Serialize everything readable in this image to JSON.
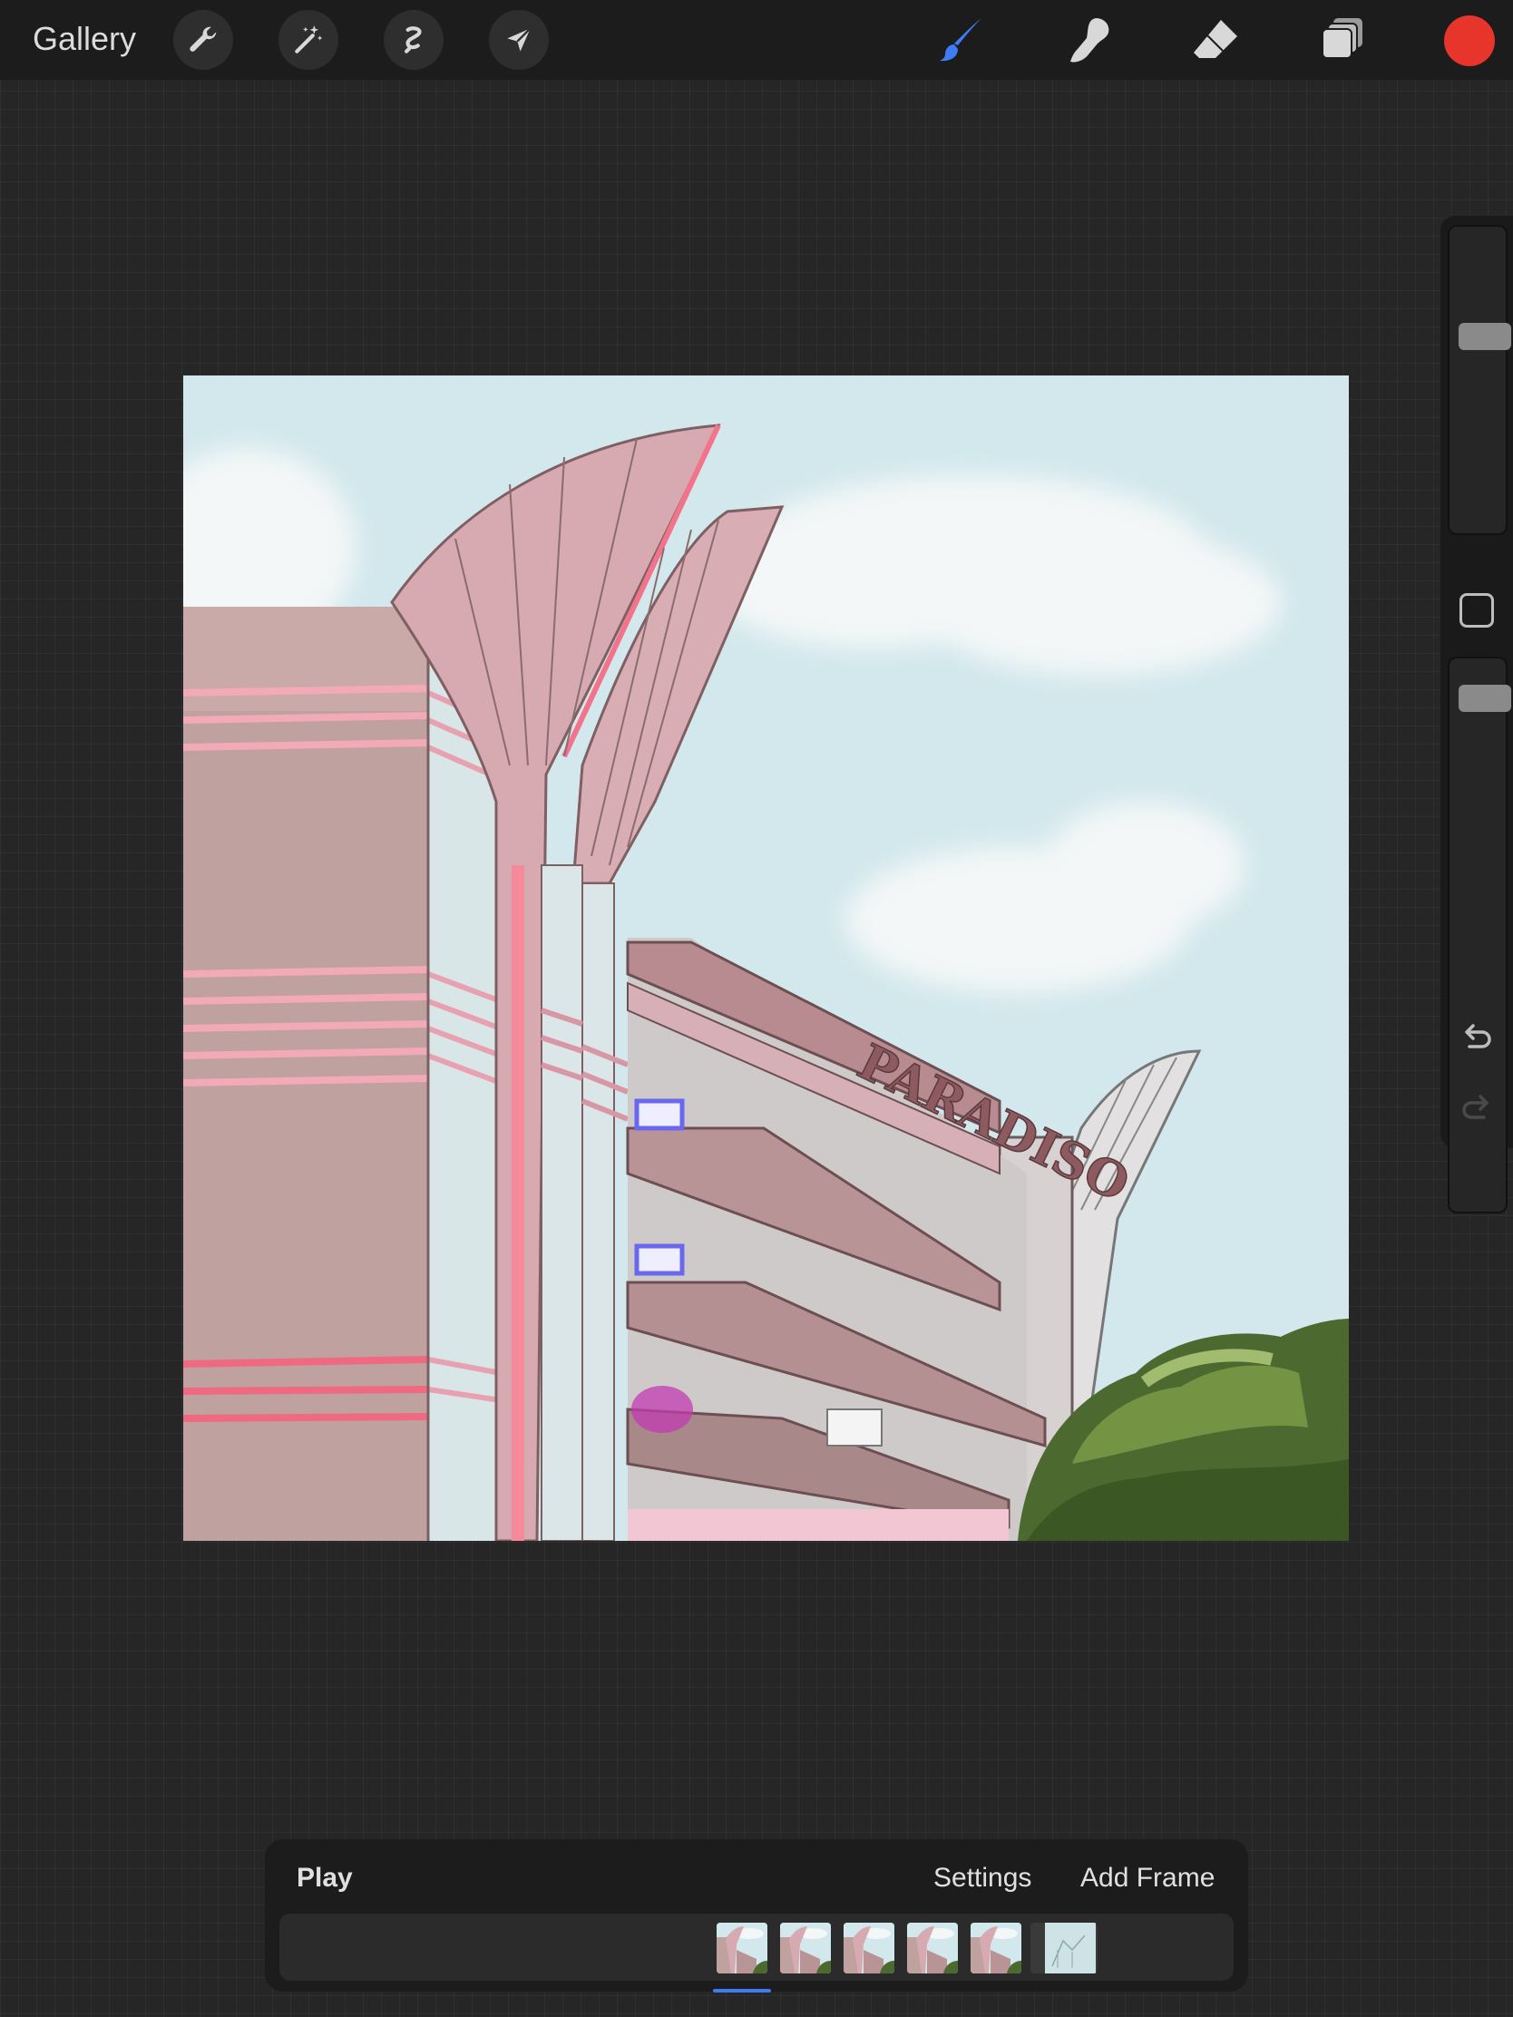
{
  "toolbar": {
    "gallery_label": "Gallery",
    "left_tools": [
      "wrench-icon",
      "magic-wand-icon",
      "selection-icon",
      "transform-arrow-icon"
    ],
    "right_tools": [
      "brush-icon",
      "smudge-icon",
      "eraser-icon",
      "layers-icon"
    ],
    "active_tool": "brush",
    "active_color": "#e8352b",
    "accent": "#3d7cf5"
  },
  "sidebar": {
    "brush_size": 0.35,
    "opacity": 0.05,
    "icons": [
      "modify-button-icon",
      "undo-icon",
      "redo-icon"
    ]
  },
  "artwork": {
    "sign_text": "PARADISO"
  },
  "animation": {
    "play_label": "Play",
    "settings_label": "Settings",
    "add_frame_label": "Add Frame",
    "frame_count": 6,
    "selected_frame": 1
  }
}
